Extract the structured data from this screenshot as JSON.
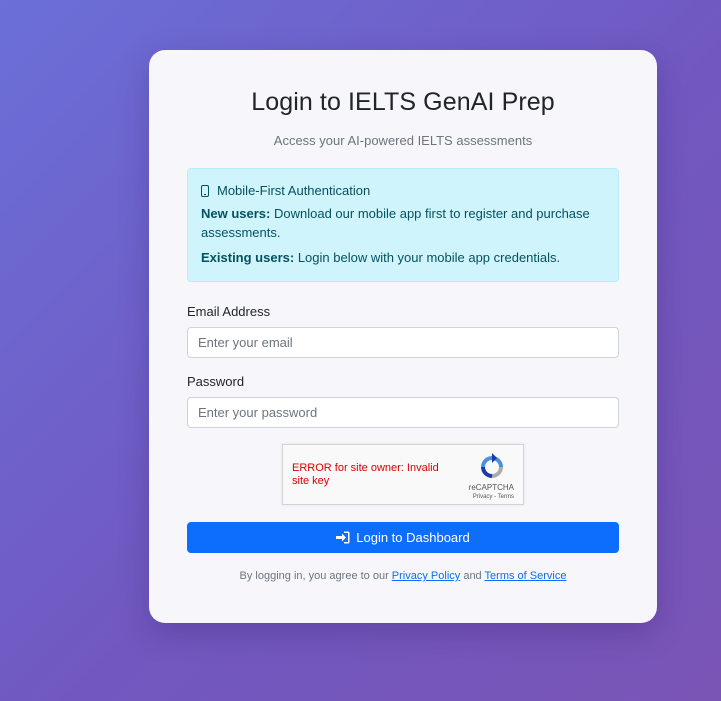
{
  "login": {
    "title": "Login to IELTS GenAI Prep",
    "subtitle": "Access your AI-powered IELTS assessments",
    "alert": {
      "icon": "mobile-phone-icon",
      "heading": "Mobile-First Authentication",
      "new_users_label": "New users:",
      "new_users_text": " Download our mobile app first to register and purchase assessments.",
      "existing_users_label": "Existing users:",
      "existing_users_text": " Login below with your mobile app credentials."
    },
    "email": {
      "label": "Email Address",
      "placeholder": "Enter your email",
      "value": ""
    },
    "password": {
      "label": "Password",
      "placeholder": "Enter your password",
      "value": ""
    },
    "recaptcha": {
      "error": "ERROR for site owner: Invalid site key",
      "brand": "reCAPTCHA",
      "privacy": "Privacy",
      "separator": " - ",
      "terms": "Terms"
    },
    "submit": {
      "icon": "sign-in-icon",
      "label": "Login to Dashboard"
    },
    "agreement": {
      "prefix": "By logging in, you agree to our ",
      "privacy_link": "Privacy Policy",
      "conjunction": " and ",
      "terms_link": "Terms of Service"
    }
  },
  "colors": {
    "primary": "#0d6efd",
    "alert_bg": "#cff4fc",
    "alert_text": "#055160",
    "error": "#dd0000"
  }
}
